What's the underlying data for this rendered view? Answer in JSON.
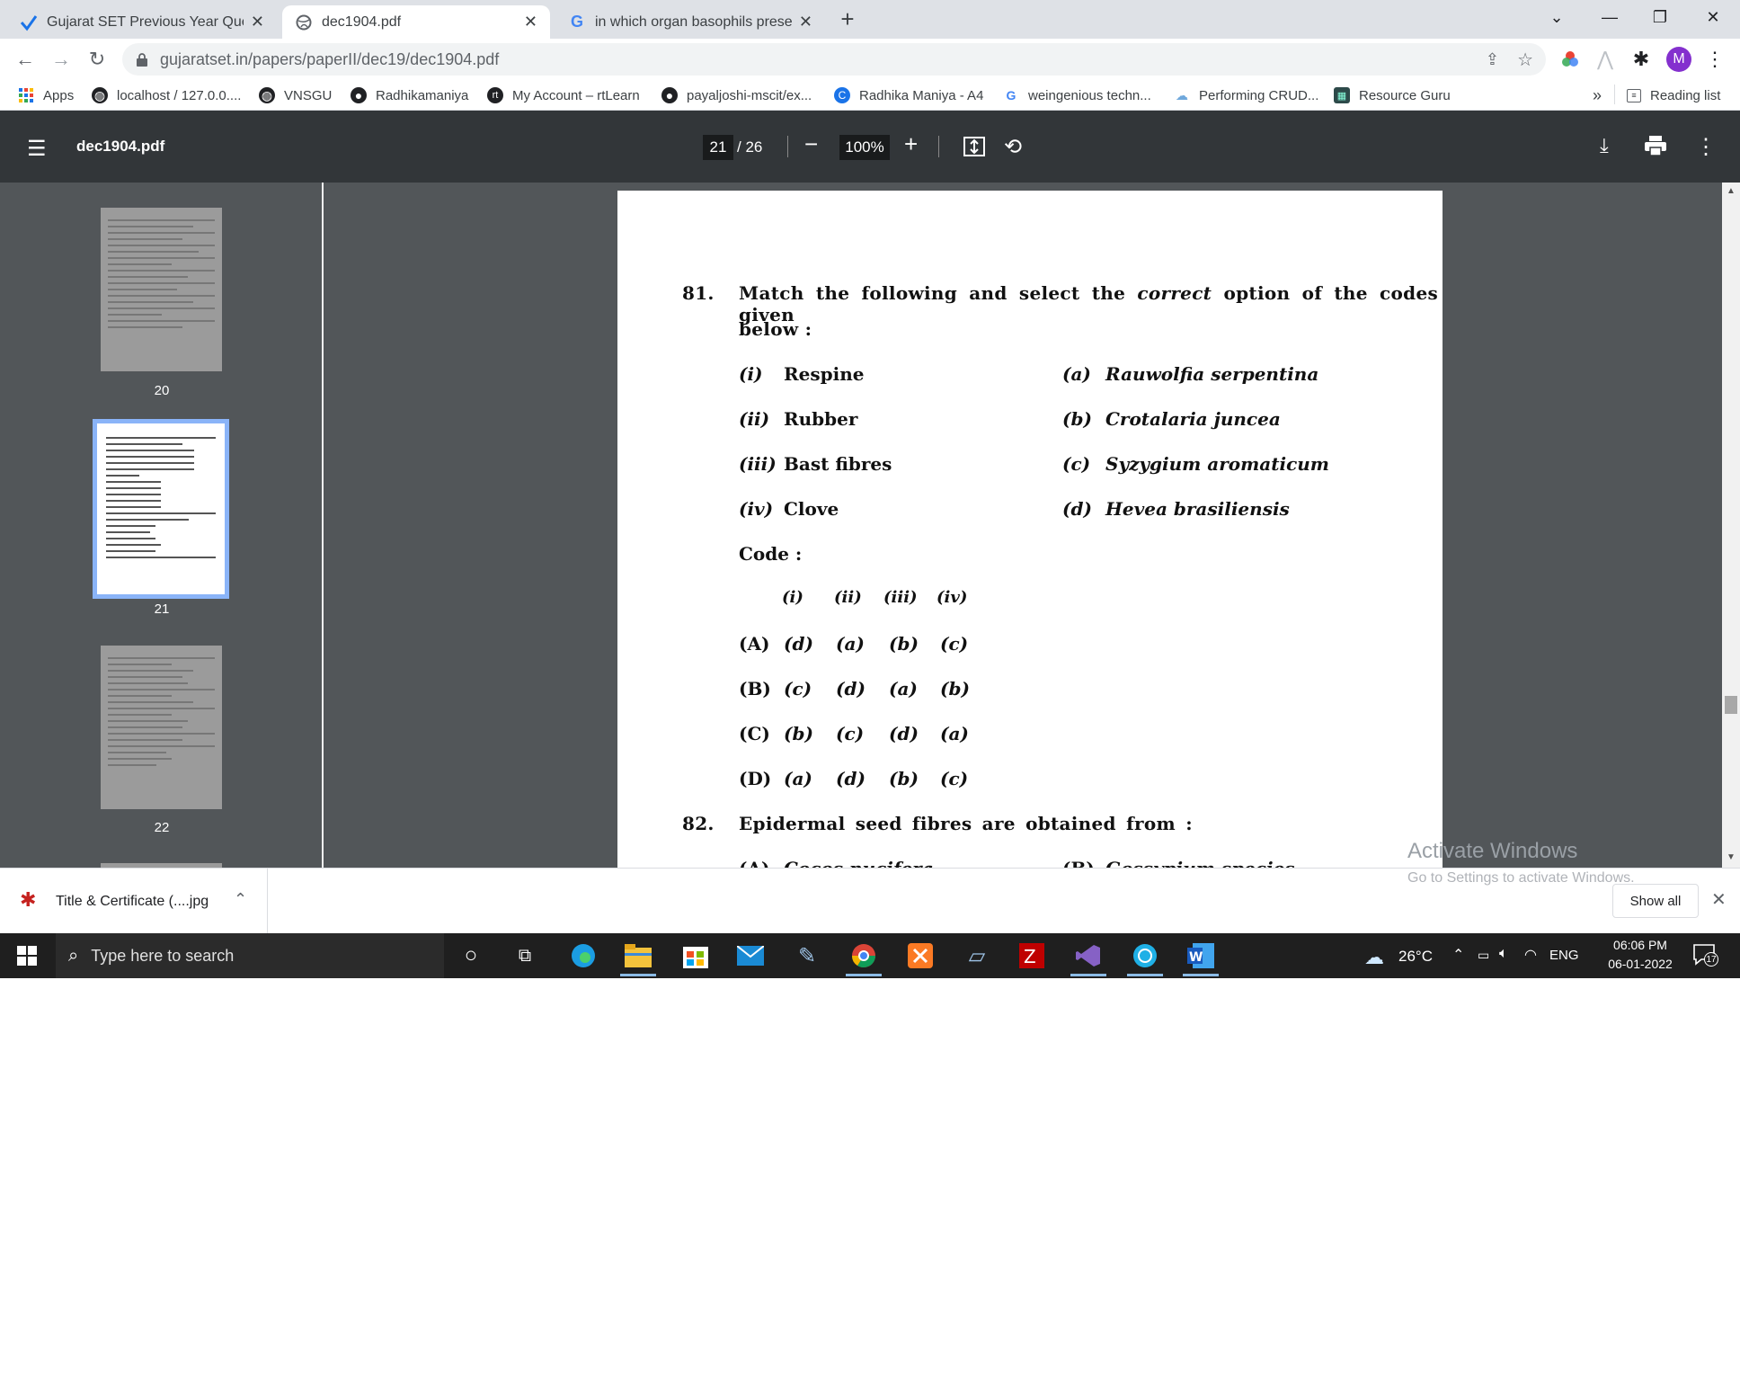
{
  "tabs": [
    {
      "title": "Gujarat SET Previous Year Questio",
      "icon": "tick-logo-icon"
    },
    {
      "title": "dec1904.pdf",
      "icon": "globe-icon"
    },
    {
      "title": "in which organ basophils present",
      "icon": "google-icon"
    }
  ],
  "window": {
    "minimize": "—",
    "restore": "❐",
    "close": "✕"
  },
  "toolbar": {
    "url": "gujaratset.in/papers/paperII/dec19/dec1904.pdf",
    "profile_initial": "M"
  },
  "bookmarks": [
    {
      "label": "Apps"
    },
    {
      "label": "localhost / 127.0.0...."
    },
    {
      "label": "VNSGU"
    },
    {
      "label": "Radhikamaniya"
    },
    {
      "label": "My Account – rtLearn"
    },
    {
      "label": "payaljoshi-mscit/ex..."
    },
    {
      "label": "Radhika Maniya - A4"
    },
    {
      "label": "weingenious techn..."
    },
    {
      "label": "Performing CRUD..."
    },
    {
      "label": "Resource Guru"
    }
  ],
  "bookmarks_more": "»",
  "reading_list": "Reading list",
  "pdf": {
    "filename": "dec1904.pdf",
    "current_page": "21",
    "total_pages": "/ 26",
    "zoom": "100%",
    "thumbnails": [
      {
        "label": "20"
      },
      {
        "label": "21"
      },
      {
        "label": "22"
      }
    ]
  },
  "question81": {
    "number": "81.",
    "text_a": "Match the following and select the",
    "text_em": "correct",
    "text_b": "option of the codes given",
    "text_c": "below :",
    "left": [
      {
        "num": "(i)",
        "label": "Respine"
      },
      {
        "num": "(ii)",
        "label": "Rubber"
      },
      {
        "num": "(iii)",
        "label": "Bast fibres"
      },
      {
        "num": "(iv)",
        "label": "Clove"
      }
    ],
    "right": [
      {
        "num": "(a)",
        "label": "Rauwolfia serpentina"
      },
      {
        "num": "(b)",
        "label": "Crotalaria juncea"
      },
      {
        "num": "(c)",
        "label": "Syzygium aromaticum"
      },
      {
        "num": "(d)",
        "label": "Hevea brasiliensis"
      }
    ],
    "code_label": "Code :",
    "code_header": [
      "(i)",
      "(ii)",
      "(iii)",
      "(iv)"
    ],
    "code_rows": [
      {
        "opt": "(A)",
        "vals": [
          "(d)",
          "(a)",
          "(b)",
          "(c)"
        ]
      },
      {
        "opt": "(B)",
        "vals": [
          "(c)",
          "(d)",
          "(a)",
          "(b)"
        ]
      },
      {
        "opt": "(C)",
        "vals": [
          "(b)",
          "(c)",
          "(d)",
          "(a)"
        ]
      },
      {
        "opt": "(D)",
        "vals": [
          "(a)",
          "(d)",
          "(b)",
          "(c)"
        ]
      }
    ]
  },
  "question82": {
    "number": "82.",
    "text": "Epidermal seed fibres are obtained from :",
    "optA": "(A)",
    "optA_label": "Cocos nucifera",
    "optB": "(B)",
    "optB_label": "Gossypium species"
  },
  "watermark": {
    "title": "Activate Windows",
    "subtitle": "Go to Settings to activate Windows."
  },
  "downloads": {
    "file": "Title & Certificate (....jpg",
    "show_all": "Show all"
  },
  "taskbar": {
    "search_placeholder": "Type here to search",
    "weather": "26°C",
    "language": "ENG",
    "time": "06:06 PM",
    "date": "06-01-2022",
    "notifications": "17"
  }
}
